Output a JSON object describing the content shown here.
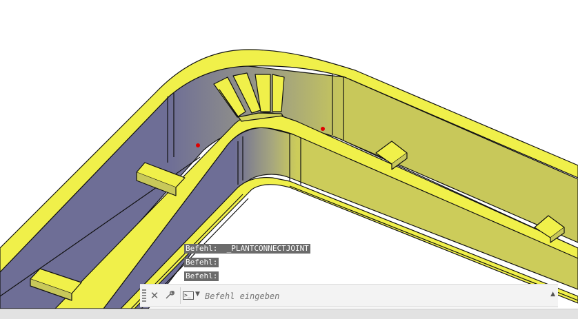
{
  "command_history": [
    "Befehl:  _PLANTCONNECTJOINT",
    "Befehl:",
    "Befehl:"
  ],
  "command_line": {
    "placeholder": "Befehl eingeben",
    "close_icon": "close-icon",
    "customize_icon": "wrench-icon",
    "prompt_icon": "command-prompt-icon",
    "history_icon": "chevron-up-icon"
  },
  "model": {
    "object": "cable-tray-elbow",
    "tray_color": "#f0f04a",
    "side_color": "#c8c85a",
    "inner_shade_color": "#6e6e96",
    "grip_color": "#e00000"
  }
}
